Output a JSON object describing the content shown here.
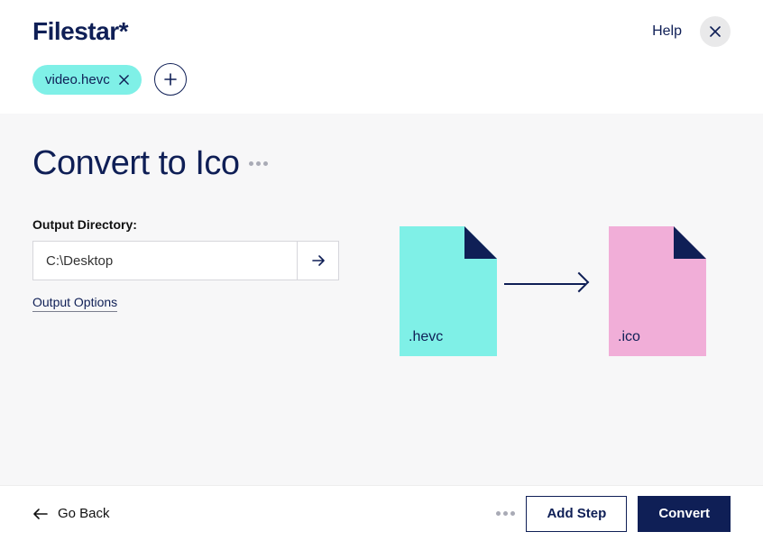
{
  "header": {
    "logo": "Filestar*",
    "help": "Help",
    "chip_label": "video.hevc"
  },
  "main": {
    "title": "Convert to Ico",
    "output_directory_label": "Output Directory:",
    "output_directory_value": "C:\\Desktop",
    "output_options": "Output Options",
    "source_ext": ".hevc",
    "target_ext": ".ico"
  },
  "footer": {
    "go_back": "Go Back",
    "add_step": "Add Step",
    "convert": "Convert"
  }
}
